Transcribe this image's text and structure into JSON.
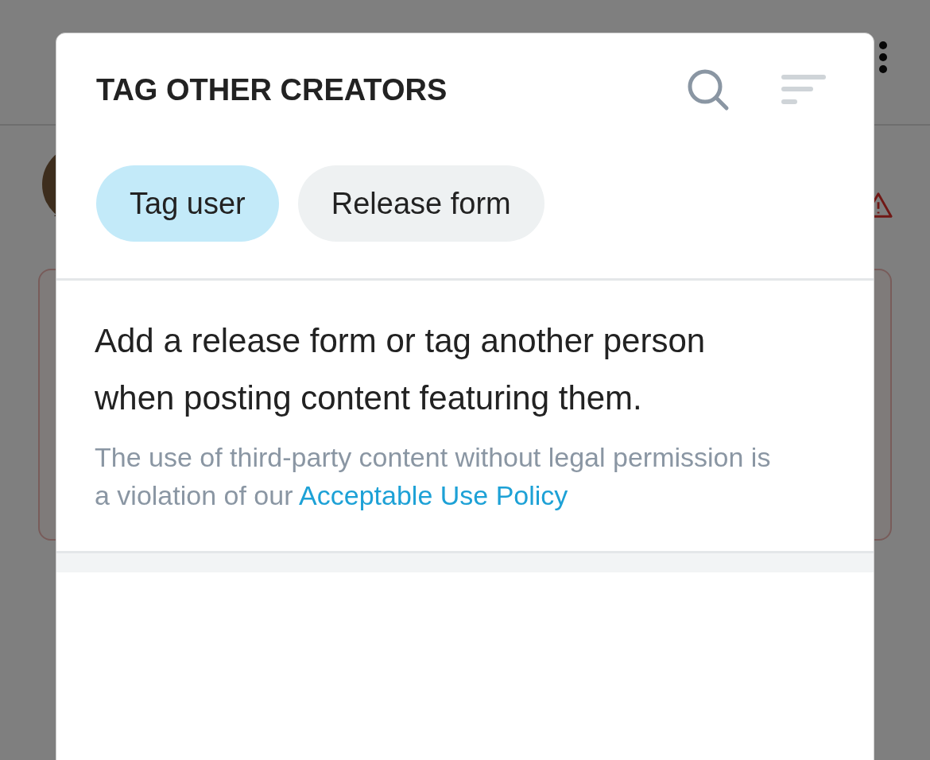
{
  "modal": {
    "title": "TAG OTHER CREATORS",
    "tabs": [
      {
        "label": "Tag user",
        "selected": true
      },
      {
        "label": "Release form",
        "selected": false
      }
    ],
    "message": "Add a release form or tag another person when posting content featuring them.",
    "note": {
      "text": "The use of third-party content without legal permission is a violation of our ",
      "link": "Acceptable Use Policy"
    }
  }
}
